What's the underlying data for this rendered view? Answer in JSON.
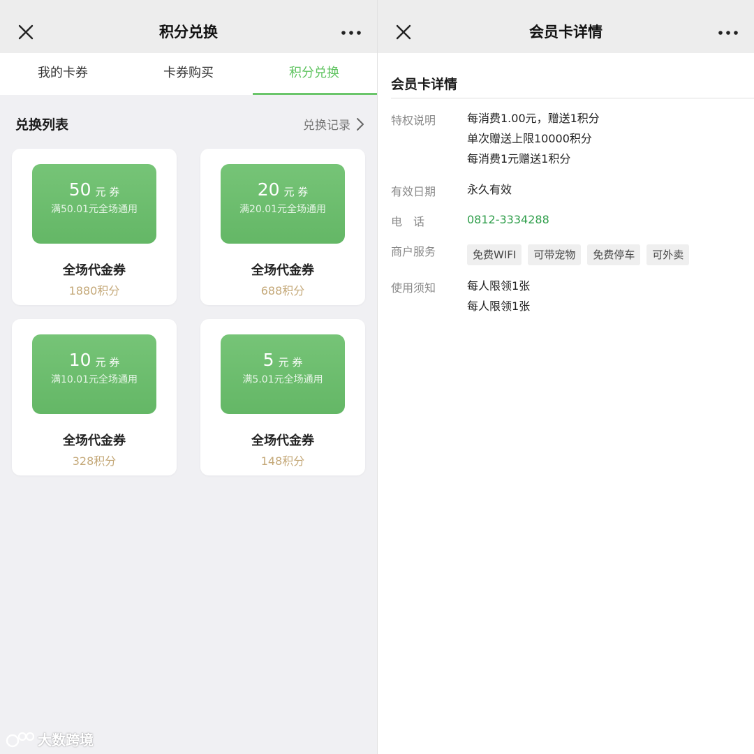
{
  "left": {
    "header": {
      "title": "积分兑换",
      "close_icon": "close-icon",
      "more_icon": "more-icon"
    },
    "tabs": [
      {
        "label": "我的卡券"
      },
      {
        "label": "卡券购买"
      },
      {
        "label": "积分兑换",
        "active": true
      }
    ],
    "section": {
      "title": "兑换列表",
      "records_label": "兑换记录"
    },
    "coupons": [
      {
        "amount": "50",
        "unit": "元 券",
        "condition": "满50.01元全场通用",
        "name": "全场代金券",
        "points": "1880积分"
      },
      {
        "amount": "20",
        "unit": "元 券",
        "condition": "满20.01元全场通用",
        "name": "全场代金券",
        "points": "688积分"
      },
      {
        "amount": "10",
        "unit": "元 券",
        "condition": "满10.01元全场通用",
        "name": "全场代金券",
        "points": "328积分"
      },
      {
        "amount": "5",
        "unit": "元 券",
        "condition": "满5.01元全场通用",
        "name": "全场代金券",
        "points": "148积分"
      }
    ]
  },
  "right": {
    "header": {
      "title": "会员卡详情",
      "close_icon": "close-icon",
      "more_icon": "more-icon"
    },
    "detail": {
      "title": "会员卡详情",
      "privilege_label": "特权说明",
      "privilege_lines": [
        "每消费1.00元，赠送1积分",
        "单次赠送上限10000积分",
        "每消费1元赠送1积分"
      ],
      "validity_label": "有效日期",
      "validity_value": "永久有效",
      "phone_label": "电　话",
      "phone_value": "0812-3334288",
      "service_label": "商户服务",
      "services": [
        "免费WIFI",
        "可带宠物",
        "免费停车",
        "可外卖"
      ],
      "notice_label": "使用须知",
      "notice_lines": [
        "每人限领1张",
        "每人限领1张"
      ]
    }
  },
  "watermark": {
    "text": "大数跨境",
    "icon": "watermark-logo-icon"
  },
  "colors": {
    "accent_green": "#5ec35f",
    "coupon_green": "#6abf6b",
    "points_gold": "#c4a878",
    "phone_green": "#2f9e4b"
  }
}
